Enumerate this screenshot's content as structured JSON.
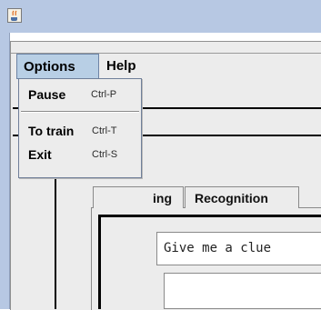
{
  "menubar": {
    "options": "Options",
    "help": "Help"
  },
  "options_menu": {
    "items": [
      {
        "label": "Pause",
        "accelerator": "Ctrl-P"
      },
      {
        "label": "To train",
        "accelerator": "Ctrl-T"
      },
      {
        "label": "Exit",
        "accelerator": "Ctrl-S"
      }
    ]
  },
  "tabs": [
    {
      "label": "ing"
    },
    {
      "label": "Recognition"
    }
  ],
  "main": {
    "clue_text": "Give me a clue"
  },
  "colors": {
    "titlebar": "#b7c8e3",
    "menu_highlight": "#b8cfe5",
    "background": "#ececec"
  },
  "icons": {
    "app": "java-coffee-icon"
  }
}
